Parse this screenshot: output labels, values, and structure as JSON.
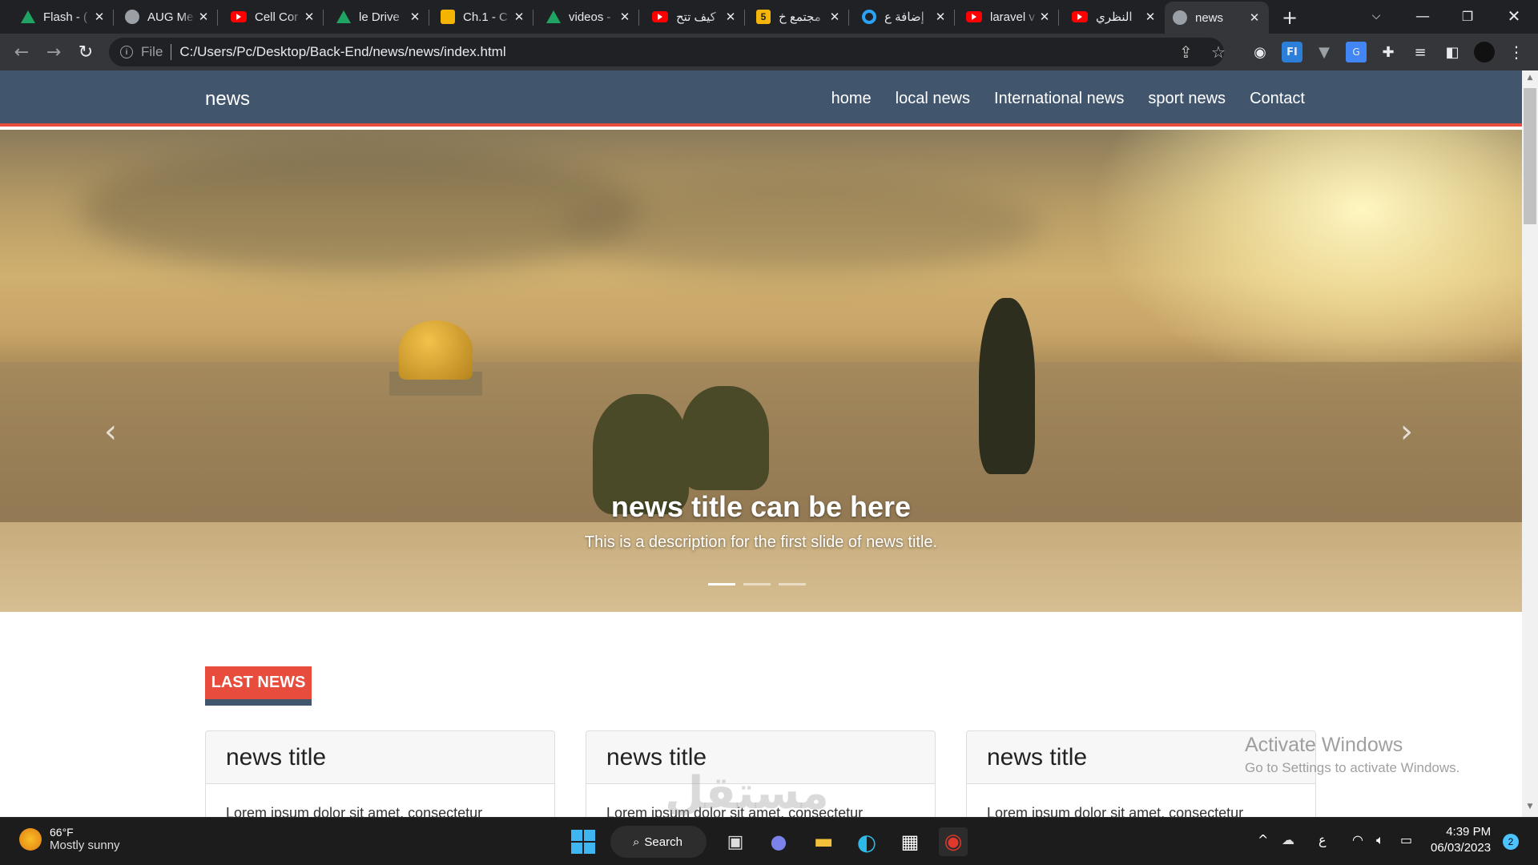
{
  "browser": {
    "tabs": [
      {
        "label": "Flash - (",
        "icon": "google-drive-icon"
      },
      {
        "label": "AUG Me",
        "icon": "globe-icon"
      },
      {
        "label": "Cell Cor",
        "icon": "youtube-icon"
      },
      {
        "label": "le Drive",
        "icon": "google-drive-icon"
      },
      {
        "label": "Ch.1 - C",
        "icon": "google-slides-icon"
      },
      {
        "label": "videos -",
        "icon": "google-drive-icon"
      },
      {
        "label": "كيف تتح",
        "icon": "youtube-icon"
      },
      {
        "label": "مجتمع خ",
        "icon": "mostaql-icon"
      },
      {
        "label": "إضافة ع",
        "icon": "ring-icon"
      },
      {
        "label": "laravel v",
        "icon": "youtube-icon"
      },
      {
        "label": "النظري",
        "icon": "youtube-icon"
      },
      {
        "label": "news",
        "icon": "globe-icon",
        "active": true
      }
    ],
    "new_tab": "+",
    "address": {
      "scheme_label": "File",
      "url": "C:/Users/Pc/Desktop/Back-End/news/news/index.html"
    }
  },
  "site": {
    "brand": "news",
    "menu": [
      "home",
      "local news",
      "International news",
      "sport news",
      "Contact"
    ],
    "carousel": {
      "title": "news title can be here",
      "description": "This is a description for the first slide of news title.",
      "slide_count": 3,
      "active_slide": 1,
      "prev": "‹",
      "next": "›"
    },
    "section_title": "LAST NEWS",
    "cards": [
      {
        "title": "news title",
        "body": "Lorem ipsum dolor sit amet, consectetur"
      },
      {
        "title": "news title",
        "body": "Lorem ipsum dolor sit amet, consectetur"
      },
      {
        "title": "news title",
        "body": "Lorem ipsum dolor sit amet, consectetur"
      }
    ]
  },
  "overlay": {
    "activate_title": "Activate Windows",
    "activate_sub": "Go to Settings to activate Windows.",
    "watermark": "مستقل"
  },
  "taskbar": {
    "weather_temp": "66°F",
    "weather_desc": "Mostly sunny",
    "search_label": "Search",
    "ime": "ع",
    "time": "4:39 PM",
    "date": "06/03/2023",
    "notifications": "2"
  },
  "colors": {
    "navbar": "#41566d",
    "accent": "#e74c3c"
  }
}
